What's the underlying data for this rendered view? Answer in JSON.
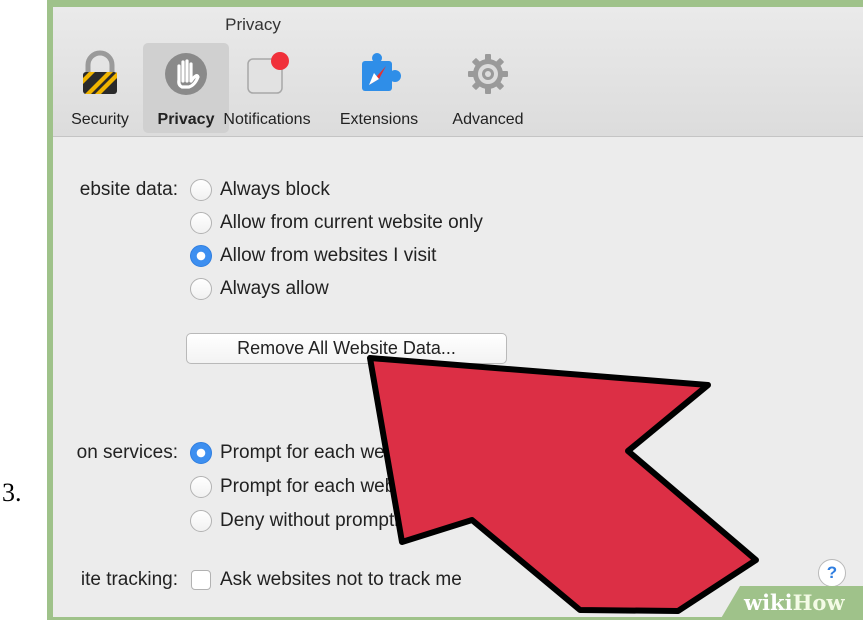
{
  "step": {
    "number": "3."
  },
  "window": {
    "title": "Privacy"
  },
  "toolbar": {
    "items": [
      {
        "label": "Security",
        "icon": "padlock-icon"
      },
      {
        "label": "Privacy",
        "icon": "hand-icon",
        "active": true
      },
      {
        "label": "Notifications",
        "icon": "notification-badge-icon"
      },
      {
        "label": "Extensions",
        "icon": "puzzle-compass-icon"
      },
      {
        "label": "Advanced",
        "icon": "gear-icon"
      }
    ]
  },
  "website_data": {
    "label": "ebsite data:",
    "options": [
      {
        "label": "Always block",
        "checked": false
      },
      {
        "label": "Allow from current website only",
        "checked": false
      },
      {
        "label": "Allow from websites I visit",
        "checked": true
      },
      {
        "label": "Always allow",
        "checked": false
      }
    ],
    "button": "Remove All Website Data..."
  },
  "location_services": {
    "label": "on services:",
    "options": [
      {
        "label": "Prompt for each webs",
        "checked": true
      },
      {
        "label": "Prompt for each website",
        "checked": false
      },
      {
        "label": "Deny without prompting",
        "checked": false
      }
    ]
  },
  "tracking": {
    "label": "ite tracking:",
    "checkbox_label": "Ask websites not to track me",
    "checked": false
  },
  "help": {
    "label": "?"
  },
  "watermark": {
    "part1": "wiki",
    "part2": "How"
  },
  "colors": {
    "frame_green": "#9fc28a",
    "arrow_red": "#dc2f45",
    "radio_blue": "#3d8ff0"
  }
}
